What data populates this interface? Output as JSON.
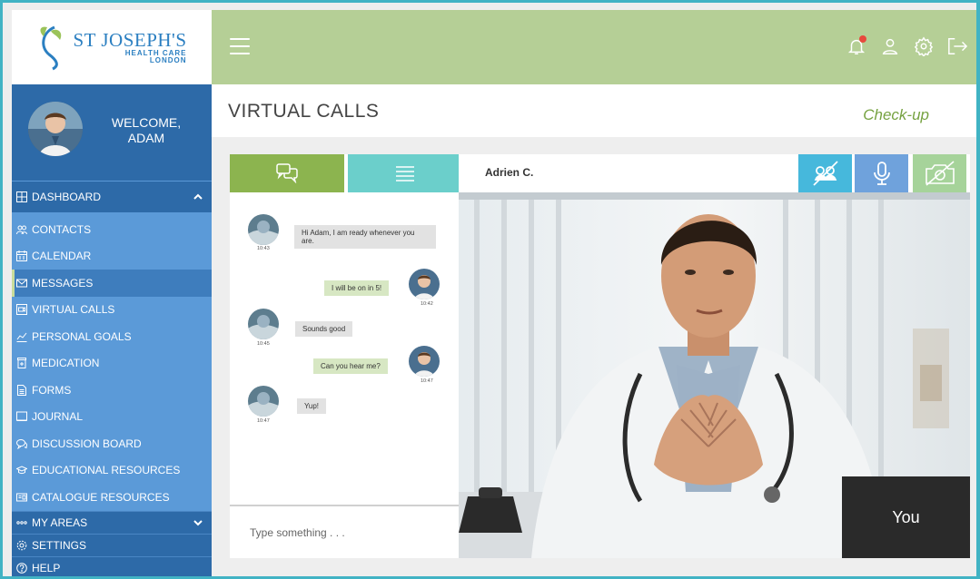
{
  "logo": {
    "title": "ST JOSEPH'S",
    "subtitle_line1": "HEALTH CARE",
    "subtitle_line2": "LONDON",
    "icon": "st-josephs-logo-mark"
  },
  "topbar": {
    "menu_icon": "hamburger-icon",
    "icons": [
      "bell-icon",
      "user-icon",
      "gear-icon",
      "logout-icon"
    ],
    "notification_dot_color": "#e8493d",
    "bg_color": "#b5cf96"
  },
  "user": {
    "welcome_line1": "WELCOME,",
    "welcome_line2": "ADAM"
  },
  "sidebar": {
    "dashboard_label": "DASHBOARD",
    "items": [
      {
        "label": "CONTACTS",
        "icon": "contacts-icon"
      },
      {
        "label": "CALENDAR",
        "icon": "calendar-icon"
      },
      {
        "label": "MESSAGES",
        "icon": "envelope-icon",
        "active": true
      },
      {
        "label": "VIRTUAL CALLS",
        "icon": "video-icon"
      },
      {
        "label": "PERSONAL GOALS",
        "icon": "chart-icon"
      },
      {
        "label": "MEDICATION",
        "icon": "medication-icon"
      },
      {
        "label": "FORMS",
        "icon": "form-icon"
      },
      {
        "label": "JOURNAL",
        "icon": "journal-icon"
      },
      {
        "label": "DISCUSSION BOARD",
        "icon": "discussion-icon"
      },
      {
        "label": "EDUCATIONAL RESOURCES",
        "icon": "graduation-icon"
      },
      {
        "label": "CATALOGUE RESOURCES",
        "icon": "catalogue-icon"
      }
    ],
    "my_areas_label": "MY AREAS",
    "settings_label": "SETTINGS",
    "help_label": "HELP"
  },
  "page": {
    "title": "VIRTUAL CALLS",
    "subtitle": "Check-up"
  },
  "chat": {
    "tabs": [
      "chat-icon",
      "list-icon"
    ],
    "messages": [
      {
        "from": "other",
        "text": "Hi Adam, I am ready whenever you are.",
        "time": "10:43"
      },
      {
        "from": "me",
        "text": "I will be on in 5!",
        "time": "10:42"
      },
      {
        "from": "other",
        "text": "Sounds good",
        "time": "10:45"
      },
      {
        "from": "me",
        "text": "Can you hear me?",
        "time": "10:47"
      },
      {
        "from": "other",
        "text": "Yup!",
        "time": "10:47"
      }
    ],
    "input_placeholder": "Type something . . ."
  },
  "call": {
    "caller_name": "Adrien C.",
    "controls": [
      "camera-off-icon",
      "microphone-icon",
      "screen-share-off-icon"
    ],
    "self_view_label": "You"
  }
}
